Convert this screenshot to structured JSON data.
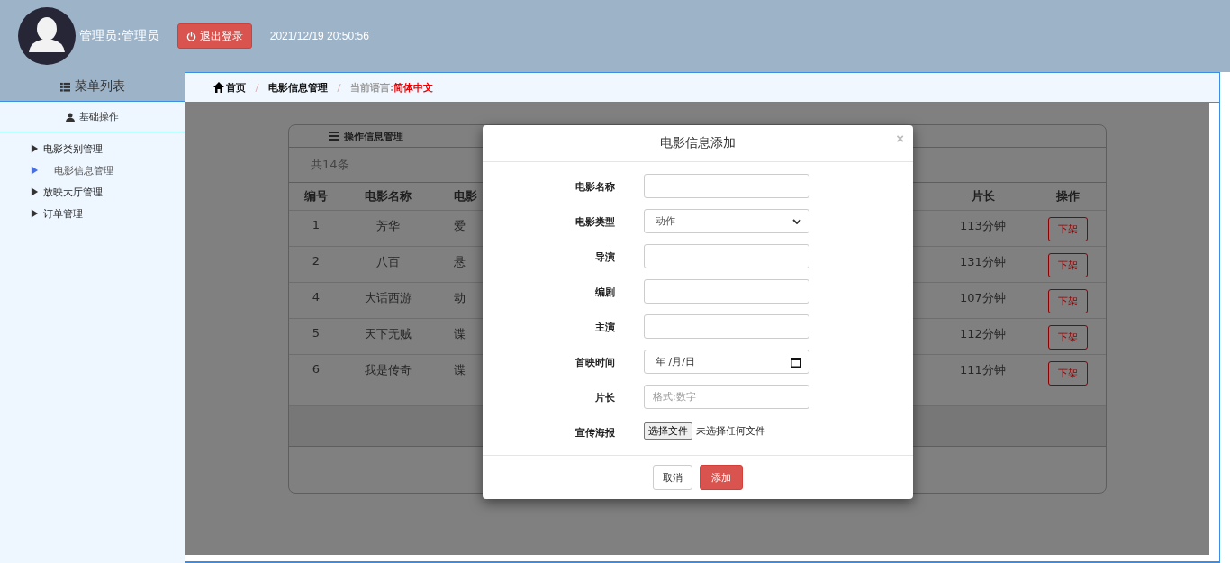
{
  "header": {
    "user": "管理员:管理员",
    "logout": "退出登录",
    "datetime": "2021/12/19 20:50:56"
  },
  "sidebar": {
    "title": "菜单列表",
    "section": "基础操作",
    "items": [
      {
        "label": "电影类别管理",
        "selected": false
      },
      {
        "label": "电影信息管理",
        "selected": true
      },
      {
        "label": "放映大厅管理",
        "selected": false
      },
      {
        "label": "订单管理",
        "selected": false
      }
    ]
  },
  "breadcrumb": {
    "items": [
      "首页",
      "电影信息管理"
    ],
    "language_label": "当前语言:",
    "language": "简体中文"
  },
  "panel": {
    "title": "操作信息管理",
    "count": "共14条",
    "columns": [
      "编号",
      "电影名称",
      "电影",
      "片长",
      "操作"
    ],
    "rows": [
      {
        "id": "1",
        "name": "芳华",
        "column_3": "爱",
        "duration": "113分钟",
        "action": "下架"
      },
      {
        "id": "2",
        "name": "八百",
        "column_3": "悬",
        "duration": "131分钟",
        "action": "下架"
      },
      {
        "id": "4",
        "name": "大话西游",
        "column_3": "动",
        "duration": "107分钟",
        "action": "下架"
      },
      {
        "id": "5",
        "name": "天下无贼",
        "column_3": "谍",
        "duration": "112分钟",
        "action": "下架"
      },
      {
        "id": "6",
        "name": "我是传奇",
        "column_3": "谍",
        "duration": "111分钟",
        "action": "下架"
      }
    ]
  },
  "modal": {
    "title": "电影信息添加",
    "close": "×",
    "fields": [
      {
        "label": "电影名称",
        "kind": "text"
      },
      {
        "label": "电影类型",
        "kind": "select",
        "value": "动作"
      },
      {
        "label": "导演",
        "kind": "text"
      },
      {
        "label": "编剧",
        "kind": "text"
      },
      {
        "label": "主演",
        "kind": "text"
      },
      {
        "label": "首映时间",
        "kind": "date",
        "value": "年 /月/日"
      },
      {
        "label": "片长",
        "kind": "text",
        "placeholder": "格式:数字"
      },
      {
        "label": "宣传海报",
        "kind": "file",
        "button": "选择文件",
        "status": "未选择任何文件"
      }
    ],
    "cancel": "取消",
    "submit": "添加"
  }
}
